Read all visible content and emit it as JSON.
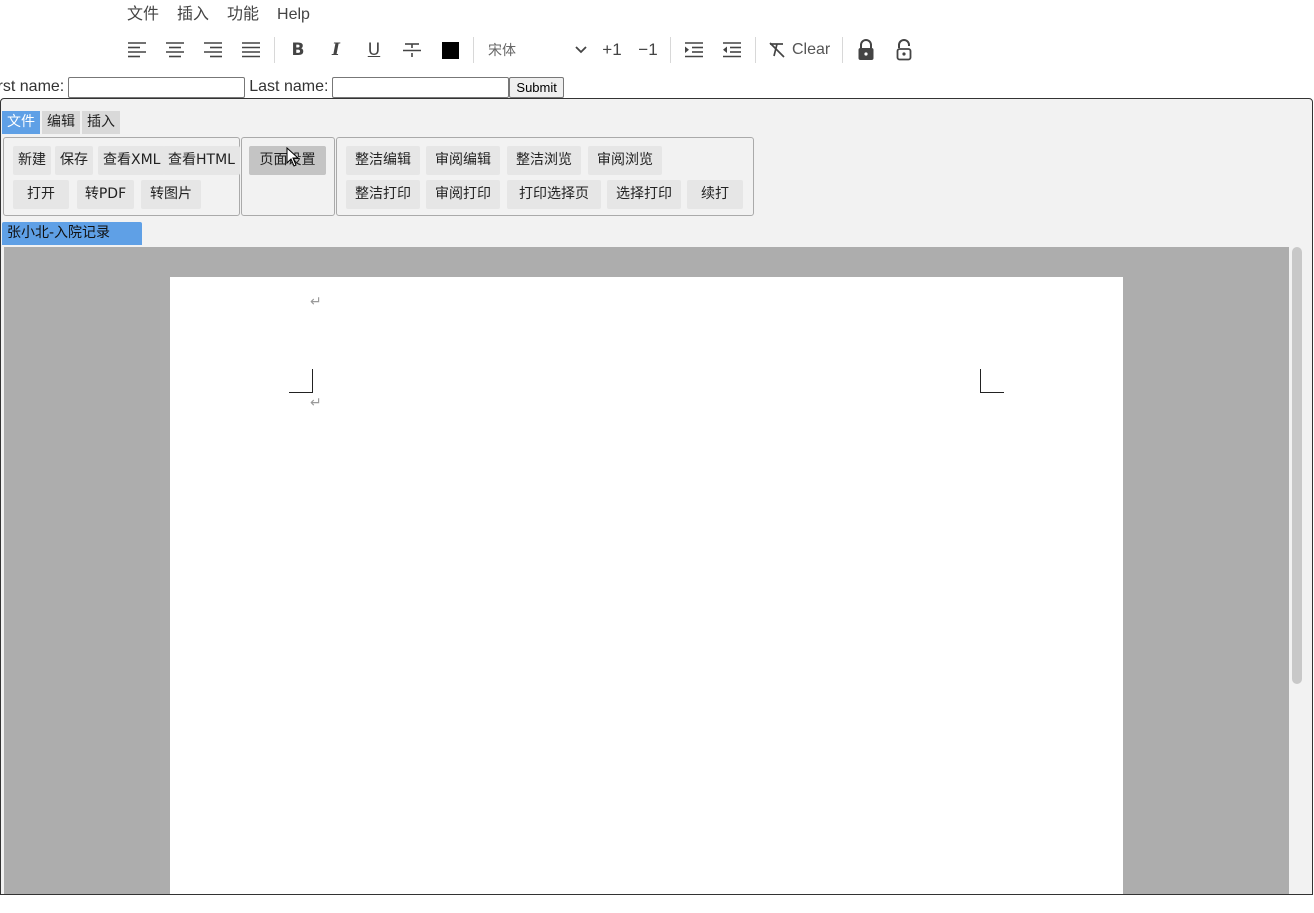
{
  "menubar": {
    "items": [
      "文件",
      "插入",
      "功能",
      "Help"
    ]
  },
  "toolbar": {
    "align_left": "align-left-icon",
    "align_center": "align-center-icon",
    "align_right": "align-right-icon",
    "align_justify": "align-justify-icon",
    "bold": "B",
    "italic": "I",
    "underline": "U",
    "strike": "strikethrough-icon",
    "font_color": "#000000",
    "font_name": "宋体",
    "increase": "+1",
    "decrease": "−1",
    "clear_label": "Clear"
  },
  "form": {
    "first_label": "irst name:",
    "first_value": "",
    "last_label": "Last name:",
    "last_value": "",
    "submit": "Submit"
  },
  "ribbon": {
    "tabs": [
      "文件",
      "编辑",
      "插入"
    ],
    "group1": {
      "row1": [
        "新建",
        "保存",
        "查看XML",
        "查看HTML"
      ],
      "row2": [
        "打开",
        "转PDF",
        "转图片"
      ]
    },
    "group2": {
      "row1": [
        "页面设置"
      ]
    },
    "group3": {
      "row1": [
        "整洁编辑",
        "审阅编辑",
        "整洁浏览",
        "审阅浏览"
      ],
      "row2": [
        "整洁打印",
        "审阅打印",
        "打印选择页",
        "选择打印",
        "续打"
      ]
    }
  },
  "document": {
    "tab_title": "张小北-入院记录",
    "paragraph_mark": "↵"
  },
  "colors": {
    "accent": "#5fa0e6",
    "canvas": "#adadad",
    "ribbon_bg": "#f2f2f2"
  }
}
